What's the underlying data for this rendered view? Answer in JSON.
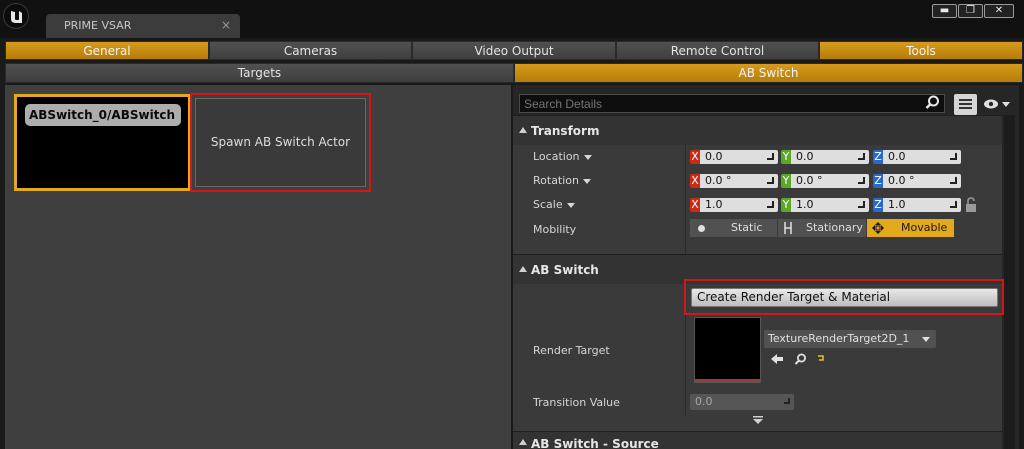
{
  "window": {
    "tab_title": "PRIME VSAR",
    "tab_close_glyph": "×",
    "minimize_glyph": "▬",
    "maximize_glyph": "❐",
    "close_glyph": "✕"
  },
  "top_tabs": [
    "General",
    "Cameras",
    "Video Output",
    "Remote Control",
    "Tools"
  ],
  "top_tabs_active": [
    "General",
    "Tools"
  ],
  "sub_tabs": [
    "Targets",
    "AB Switch"
  ],
  "sub_tabs_active": "AB Switch",
  "left_panel": {
    "ab_card_label": "ABSwitch_0/ABSwitch",
    "spawn_button": "Spawn AB Switch Actor"
  },
  "details": {
    "search_placeholder": "Search Details",
    "transform": {
      "title": "Transform",
      "location": {
        "label": "Location",
        "x": "0.0",
        "y": "0.0",
        "z": "0.0"
      },
      "rotation": {
        "label": "Rotation",
        "x": "0.0 °",
        "y": "0.0 °",
        "z": "0.0 °"
      },
      "scale": {
        "label": "Scale",
        "x": "1.0",
        "y": "1.0",
        "z": "1.0"
      },
      "mobility": {
        "label": "Mobility",
        "options": [
          "Static",
          "Stationary",
          "Movable"
        ],
        "selected": "Movable"
      }
    },
    "ab_switch": {
      "title": "AB Switch",
      "create_button": "Create Render Target & Material",
      "render_target_label": "Render Target",
      "render_target_value": "TextureRenderTarget2D_1",
      "transition_label": "Transition Value",
      "transition_value": "0.0"
    },
    "ab_switch_source": {
      "title": "AB Switch - Source"
    }
  },
  "colors": {
    "accent_orange": "#e3a81c",
    "highlight_red": "#d11717",
    "axis_x": "#cc2a12",
    "axis_y": "#5aa82a",
    "axis_z": "#2a68c9"
  }
}
